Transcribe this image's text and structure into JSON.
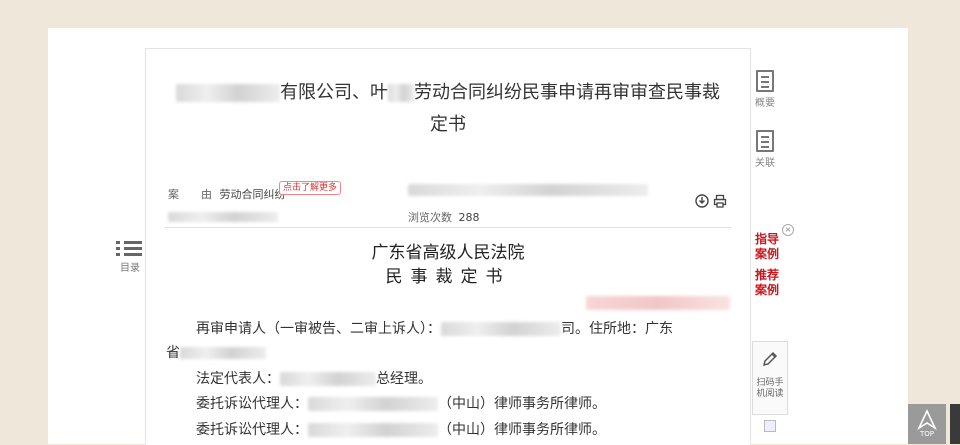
{
  "doc": {
    "title_line1": "有限公司、叶",
    "title_line1b": "劳动合同纠纷民事申请再审审查民事裁",
    "title_line2": "定书",
    "cause_label": "案　　由",
    "cause_value": "劳动合同纠纷",
    "more_badge": "点击了解更多",
    "views_label": "浏览次数",
    "views_value": "288",
    "court_name": "广东省高级人民法院",
    "doc_type": "民事裁定书",
    "paragraphs": {
      "p1a": "再审申请人（一审被告、二审上诉人）：",
      "p1b": "司。住所地：广东",
      "p1c": "省",
      "p2a": "法定代表人：",
      "p2b": "总经理。",
      "p3a": "委托诉讼代理人：",
      "p3b": "（中山）律师事务所律师。",
      "p4a": "委托诉讼代理人：",
      "p4b": "（中山）律师事务所律师。"
    }
  },
  "sidebar": {
    "summary_label": "概要",
    "related_label": "关联",
    "toc_label": "目录",
    "guide_case": "指导案例",
    "recommend_case": "推荐案例",
    "scan_label": "扫码手机阅读",
    "top_label": "TOP"
  }
}
